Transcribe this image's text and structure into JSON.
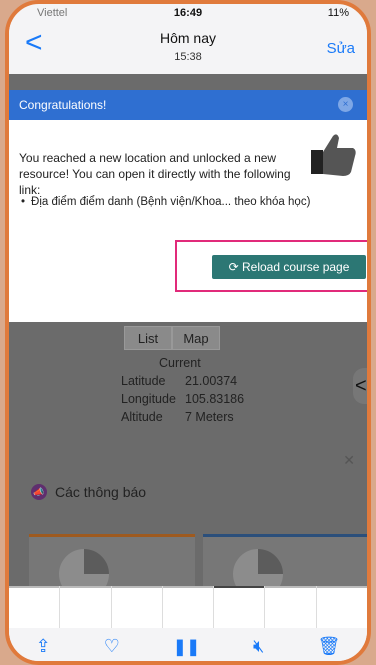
{
  "status": {
    "carrier": "Viettel",
    "time": "16:49",
    "battery": "11%"
  },
  "nav": {
    "back": "<",
    "title": "Hôm nay",
    "subtitle": "15:38",
    "edit": "Sửa"
  },
  "modal": {
    "header": "Congratulations!",
    "body": "You reached a new location and unlocked a new resource! You can open it directly with the following link:",
    "link": "Địa điểm điểm danh (Bệnh viện/Khoa... theo khóa học)",
    "button": "⟳ Reload course page"
  },
  "geo": {
    "tabs": [
      "List",
      "Map"
    ],
    "current": "Current",
    "lat_label": "Latitude",
    "lat": "21.00374",
    "lon_label": "Longitude",
    "lon": "105.83186",
    "alt_label": "Altitude",
    "alt": "7 Meters"
  },
  "notices": {
    "title": "Các thông báo"
  },
  "toolbar": {
    "icons": [
      "share-icon",
      "heart-icon",
      "pause-icon",
      "mute-icon",
      "trash-icon"
    ]
  }
}
